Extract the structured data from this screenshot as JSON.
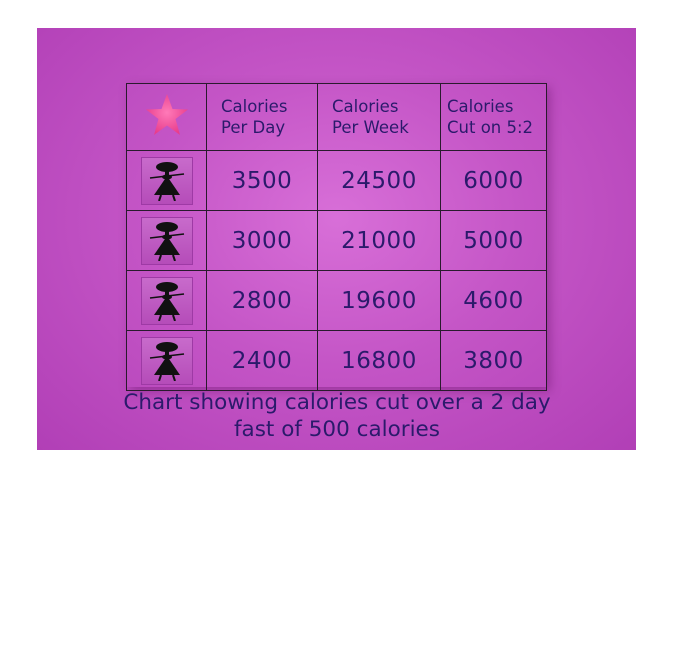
{
  "chart_data": {
    "type": "table",
    "columns": [
      "",
      "Calories Per Day",
      "Calories Per Week",
      "Calories Cut on 5:2"
    ],
    "header_lines": [
      [
        "Calories",
        "Per Day"
      ],
      [
        "Calories",
        "Per Week"
      ],
      [
        "Calories",
        "Cut on 5:2"
      ]
    ],
    "rows": [
      {
        "per_day": "3500",
        "per_week": "24500",
        "cut": "6000"
      },
      {
        "per_day": "3000",
        "per_week": "21000",
        "cut": "5000"
      },
      {
        "per_day": "2800",
        "per_week": "19600",
        "cut": "4600"
      },
      {
        "per_day": "2400",
        "per_week": "16800",
        "cut": "3800"
      }
    ],
    "caption": "Chart showing calories cut over a 2 day fast of 500 calories"
  },
  "colors": {
    "background": "#c455c6",
    "text": "#2b1a6b",
    "star": "#f0509a",
    "grid": "#2a1a2e"
  },
  "icons": {
    "header": "star-icon",
    "row": "person-icon"
  }
}
